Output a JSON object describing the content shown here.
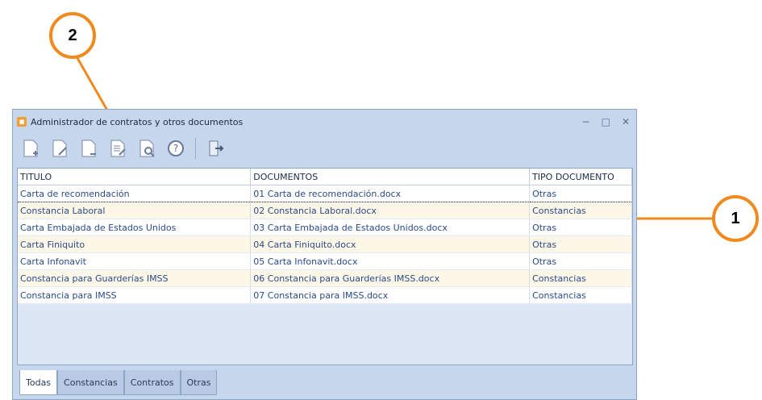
{
  "window": {
    "title": "Administrador de contratos y otros documentos",
    "app_icon": "app-icon"
  },
  "window_controls": {
    "minimize": "−",
    "maximize": "□",
    "close": "✕"
  },
  "toolbar": {
    "buttons": [
      "new-document-icon",
      "edit-document-icon",
      "remove-document-icon",
      "open-document-icon",
      "preview-document-icon",
      "help-icon",
      "exit-icon"
    ]
  },
  "table": {
    "columns": [
      "TITULO",
      "DOCUMENTOS",
      "TIPO DOCUMENTO"
    ],
    "rows": [
      [
        "Carta de recomendación",
        "01 Carta de recomendación.docx",
        "Otras"
      ],
      [
        "Constancia Laboral",
        "02 Constancia Laboral.docx",
        "Constancias"
      ],
      [
        "Carta Embajada de Estados Unidos",
        "03 Carta Embajada de Estados Unidos.docx",
        "Otras"
      ],
      [
        "Carta Finiquito",
        "04 Carta Finiquito.docx",
        "Otras"
      ],
      [
        "Carta Infonavit",
        "05 Carta Infonavit.docx",
        "Otras"
      ],
      [
        "Constancia para Guarderías IMSS",
        "06 Constancia para Guarderías IMSS.docx",
        "Constancias"
      ],
      [
        "Constancia para IMSS",
        "07 Constancia para IMSS.docx",
        "Constancias"
      ]
    ]
  },
  "tabs": [
    "Todas",
    "Constancias",
    "Contratos",
    "Otras"
  ],
  "active_tab": "Todas",
  "callouts": {
    "one": "1",
    "two": "2"
  },
  "accent_color": "#f08a1e"
}
